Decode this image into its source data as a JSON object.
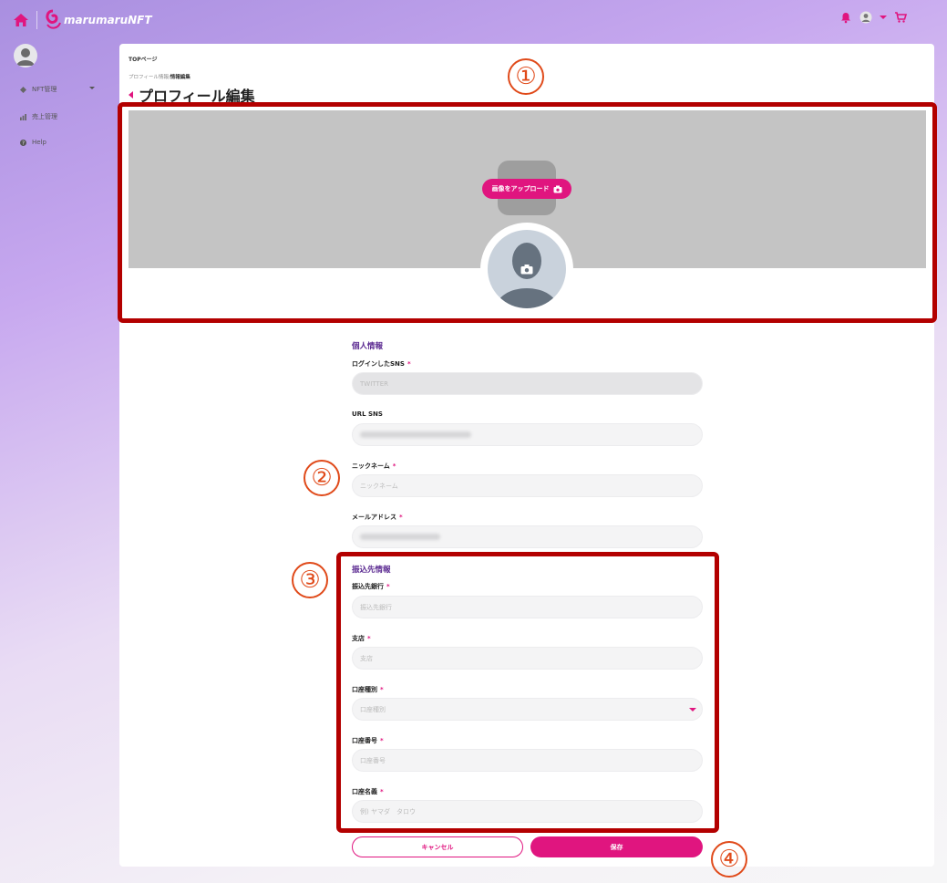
{
  "header": {
    "logo_text": "marumaruNFT",
    "accent_color": "#e0157f",
    "icons": [
      "home-icon",
      "bell-icon",
      "user-icon",
      "cart-icon"
    ]
  },
  "sidebar": {
    "items": [
      {
        "label": "NFT管理",
        "icon": "diamond-icon"
      },
      {
        "label": "売上管理",
        "icon": "bar-chart-icon"
      },
      {
        "label": "Help",
        "icon": "help-icon"
      }
    ]
  },
  "breadcrumb": {
    "top": "TOPページ",
    "path_parent": "プロフィール情報/",
    "path_current": "情報編集"
  },
  "page": {
    "title": "プロフィール編集"
  },
  "cover": {
    "upload_label": "画像をアップロード"
  },
  "personal": {
    "section_title": "個人情報",
    "login_sns_label": "ログインしたSNS",
    "login_sns_value": "TWITTER",
    "url_sns_label": "URL SNS",
    "nickname_label": "ニックネーム",
    "nickname_placeholder": "ニックネーム",
    "email_label": "メールアドレス"
  },
  "bank": {
    "section_title": "振込先情報",
    "bank_label": "振込先銀行",
    "bank_placeholder": "振込先銀行",
    "branch_label": "支店",
    "branch_placeholder": "支店",
    "type_label": "口座種別",
    "type_value": "口座種別",
    "number_label": "口座番号",
    "number_placeholder": "口座番号",
    "holder_label": "口座名義",
    "holder_placeholder": "例) ヤマダ　タロウ"
  },
  "actions": {
    "cancel_label": "キャンセル",
    "save_label": "保存"
  },
  "annotations": [
    "①",
    "②",
    "③",
    "④"
  ],
  "required_mark": "*"
}
